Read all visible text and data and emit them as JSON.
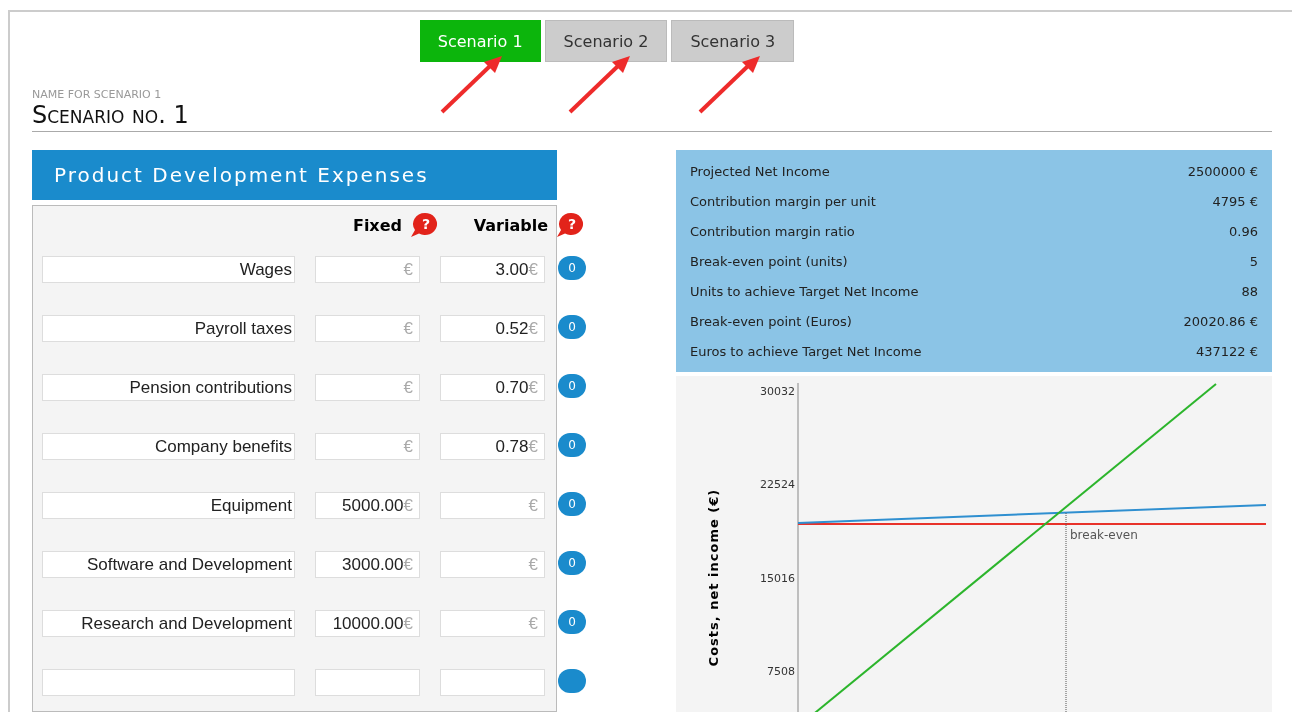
{
  "tabs": [
    {
      "label": "Scenario 1",
      "selected": true
    },
    {
      "label": "Scenario 2",
      "selected": false
    },
    {
      "label": "Scenario 3",
      "selected": false
    }
  ],
  "scenario_name": {
    "label": "NAME FOR SCENARIO 1",
    "value": "Scenario no. 1"
  },
  "expenses": {
    "title": "Product Development Expenses",
    "columns": [
      {
        "label": "Fixed",
        "help": "?"
      },
      {
        "label": "Variable",
        "help": "?"
      }
    ],
    "rows": [
      {
        "name": "Wages",
        "fixed_unit": "€",
        "variable": "3.00",
        "variable_unit": "€",
        "count": "0"
      },
      {
        "name": "Payroll taxes",
        "fixed_unit": "€",
        "variable": "0.52",
        "variable_unit": "€",
        "count": "0"
      },
      {
        "name": "Pension contributions",
        "fixed_unit": "€",
        "variable": "0.70",
        "variable_unit": "€",
        "count": "0"
      },
      {
        "name": "Company benefits",
        "fixed_unit": "€",
        "variable": "0.78",
        "variable_unit": "€",
        "count": "0"
      },
      {
        "name": "Equipment",
        "fixed": "5000.00",
        "fixed_unit": "€",
        "variable_unit": "€",
        "count": "0"
      },
      {
        "name": "Software and Development",
        "fixed": "3000.00",
        "fixed_unit": "€",
        "variable_unit": "€",
        "count": "0"
      },
      {
        "name": "Research and Development",
        "fixed": "10000.00",
        "fixed_unit": "€",
        "variable_unit": "€",
        "count": "0"
      },
      {}
    ]
  },
  "summary": [
    {
      "label": "Projected Net Income",
      "value": "2500000 €"
    },
    {
      "label": "Contribution margin per unit",
      "value": "4795 €"
    },
    {
      "label": "Contribution margin ratio",
      "value": "0.96"
    },
    {
      "label": "Break-even point (units)",
      "value": "5"
    },
    {
      "label": "Units to achieve Target Net Income",
      "value": "88"
    },
    {
      "label": "Break-even point (Euros)",
      "value": "20020.86 €"
    },
    {
      "label": "Euros to achieve Target Net Income",
      "value": "437122 €"
    }
  ],
  "chart": {
    "ylabel": "Costs, net income (€)",
    "yticks": [
      "30032",
      "22524",
      "15016",
      "7508"
    ],
    "annotation": "break-even"
  }
}
